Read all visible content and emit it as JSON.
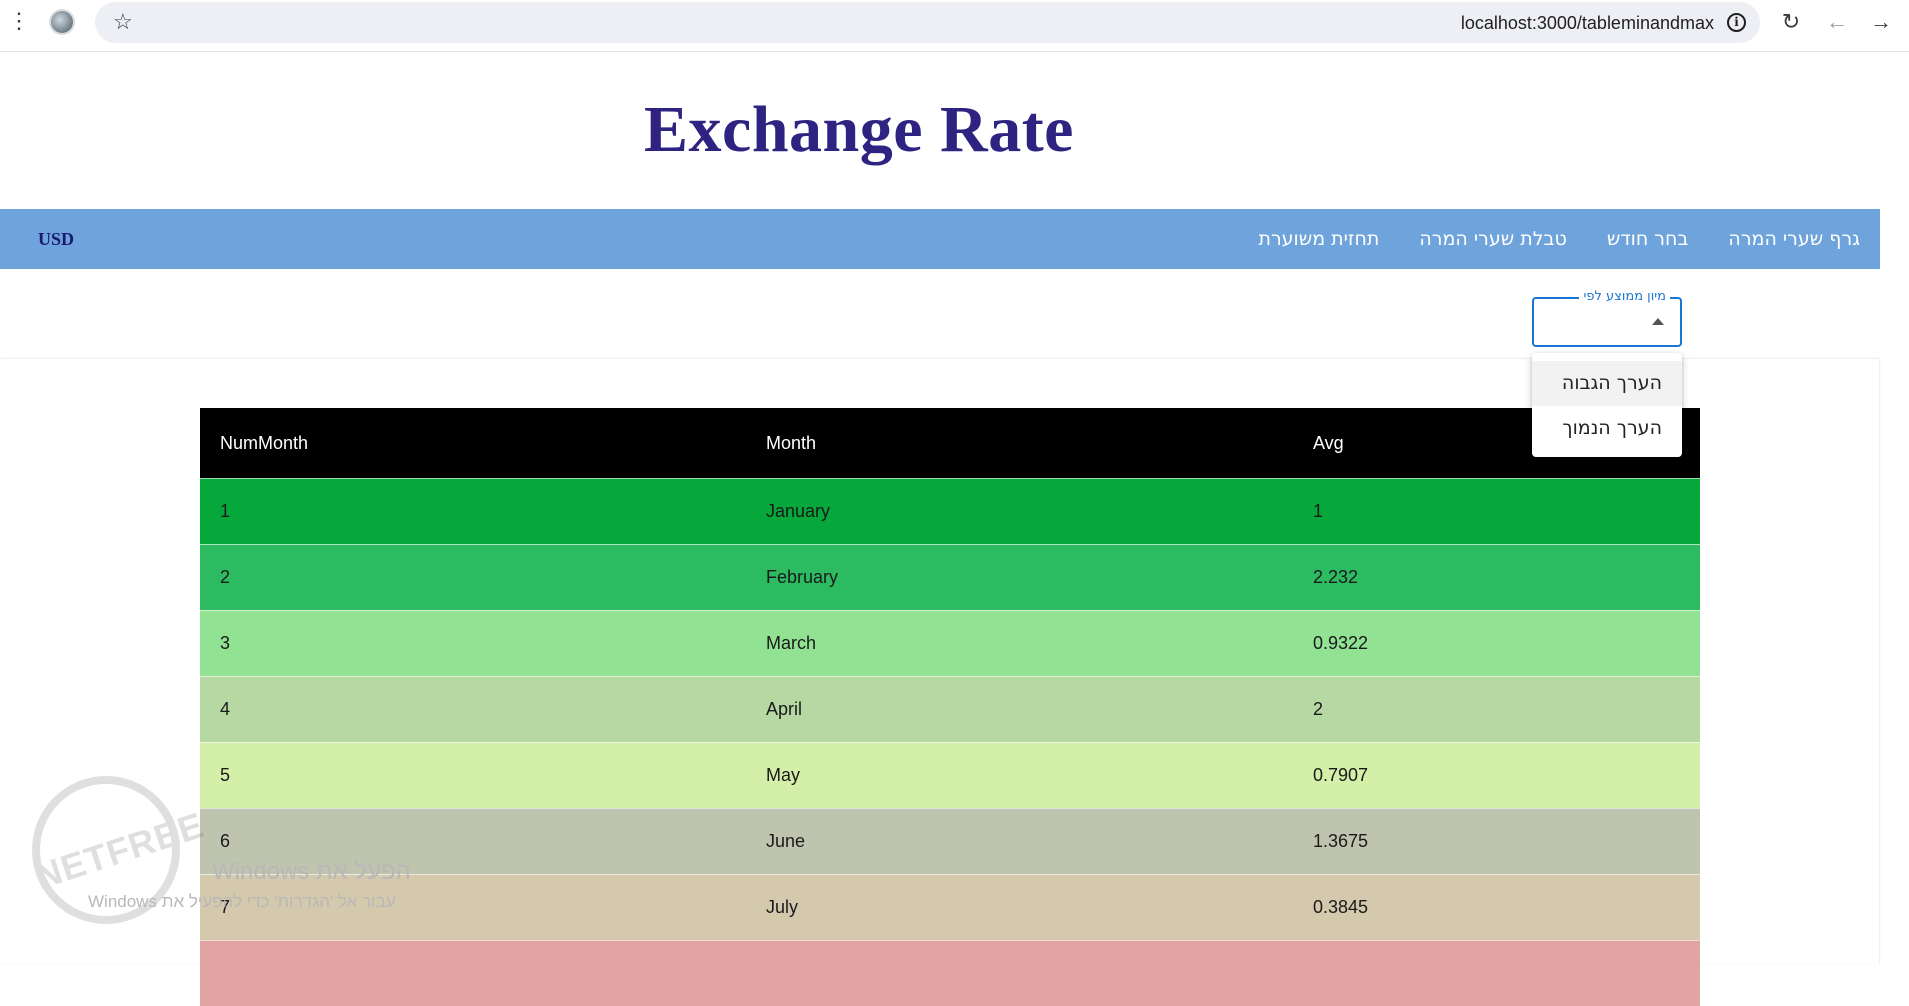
{
  "browser": {
    "url": "localhost:3000/tableminandmax",
    "menu_icon": "kebab-menu-icon",
    "bookmark_icon": "star-icon",
    "info_icon": "info-icon",
    "info_glyph": "i",
    "reload_icon": "reload-icon",
    "back_icon": "back-arrow-icon",
    "forward_icon": "forward-arrow-icon"
  },
  "header": {
    "title": "Exchange Rate"
  },
  "navbar": {
    "currency": "USD",
    "links": [
      "גרף שערי המרה",
      "בחר חודש",
      "טבלת שערי המרה",
      "תחזית משוערת"
    ]
  },
  "sort_select": {
    "label": "מיון ממוצע לפי",
    "value": "",
    "options": [
      "הערך הגבוה",
      "הערך הנמוך"
    ]
  },
  "table": {
    "headers": [
      "NumMonth",
      "Month",
      "Avg"
    ],
    "header_bg": "#000000",
    "rows": [
      {
        "num": "1",
        "month": "January",
        "avg": "1",
        "color": "#07a83b"
      },
      {
        "num": "2",
        "month": "February",
        "avg": "2.232",
        "color": "#2dbb62"
      },
      {
        "num": "3",
        "month": "March",
        "avg": "0.9322",
        "color": "#92e294"
      },
      {
        "num": "4",
        "month": "April",
        "avg": "2",
        "color": "#b6d8a2"
      },
      {
        "num": "5",
        "month": "May",
        "avg": "0.7907",
        "color": "#d4efa8"
      },
      {
        "num": "6",
        "month": "June",
        "avg": "1.3675",
        "color": "#bfc4ae"
      },
      {
        "num": "7",
        "month": "July",
        "avg": "0.3845",
        "color": "#d4c8ad"
      },
      {
        "num": "",
        "month": "",
        "avg": "",
        "color": "#e2a3a3"
      }
    ]
  },
  "overlay": {
    "watermark_text": "NETFREE",
    "activate_title": "הפעל את Windows",
    "activate_sub": "עבור אל 'הגדרות' כדי להפעיל את Windows"
  }
}
